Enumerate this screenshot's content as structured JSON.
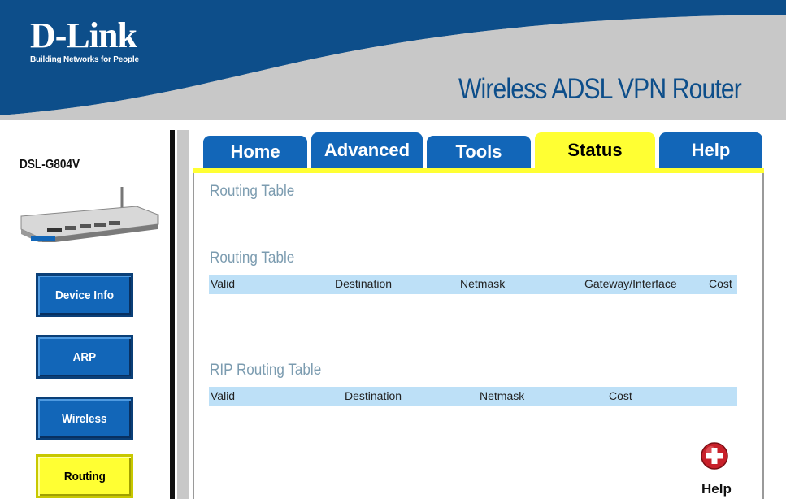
{
  "brand": {
    "logo": "D-Link",
    "tagline": "Building Networks for People",
    "product_title": "Wireless ADSL VPN Router",
    "colors": {
      "blue": "#1266b8",
      "dark_blue": "#0a3f78",
      "active_yellow": "#ffff33",
      "header_grey": "#c8c8c8"
    }
  },
  "sidebar": {
    "model": "DSL-G804V",
    "items": [
      {
        "label": "Device Info",
        "active": false
      },
      {
        "label": "ARP",
        "active": false
      },
      {
        "label": "Wireless",
        "active": false
      },
      {
        "label": "Routing",
        "active": true
      }
    ]
  },
  "tabs": [
    {
      "label": "Home",
      "active": false
    },
    {
      "label": "Advanced",
      "active": false
    },
    {
      "label": "Tools",
      "active": false
    },
    {
      "label": "Status",
      "active": true
    },
    {
      "label": "Help",
      "active": false
    }
  ],
  "main": {
    "page_title": "Routing Table",
    "routing_table": {
      "title": "Routing Table",
      "columns": [
        "Valid",
        "Destination",
        "Netmask",
        "Gateway/Interface",
        "Cost"
      ]
    },
    "rip_table": {
      "title": "RIP Routing Table",
      "columns": [
        "Valid",
        "Destination",
        "Netmask",
        "Cost"
      ]
    },
    "help": {
      "label": "Help",
      "icon": "plus-circle-icon"
    }
  }
}
